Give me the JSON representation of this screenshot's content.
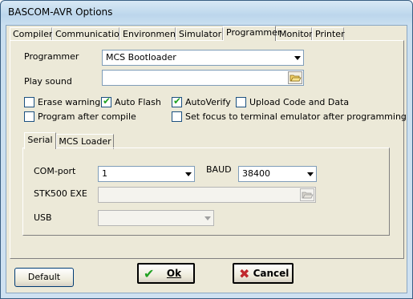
{
  "window": {
    "title": "BASCOM-AVR Options"
  },
  "tabs": [
    {
      "label": "Compiler"
    },
    {
      "label": "Communication"
    },
    {
      "label": "Environment"
    },
    {
      "label": "Simulator"
    },
    {
      "label": "Programmer",
      "active": true
    },
    {
      "label": "Monitor"
    },
    {
      "label": "Printer"
    }
  ],
  "programmer": {
    "label": "Programmer",
    "value": "MCS Bootloader",
    "play_sound_label": "Play sound",
    "play_sound_value": ""
  },
  "options": {
    "erase_warning": {
      "label": "Erase warning",
      "checked": false
    },
    "auto_flash": {
      "label": "Auto Flash",
      "checked": true
    },
    "auto_verify": {
      "label": "AutoVerify",
      "checked": true
    },
    "upload_code": {
      "label": "Upload Code and Data",
      "checked": false
    },
    "program_after_compile": {
      "label": "Program after compile",
      "checked": false
    },
    "set_focus": {
      "label": "Set focus to terminal emulator after programming",
      "checked": false
    }
  },
  "subtabs": [
    {
      "label": "Serial",
      "active": true
    },
    {
      "label": "MCS Loader"
    }
  ],
  "serial": {
    "com_port_label": "COM-port",
    "com_port_value": "1",
    "baud_label": "BAUD",
    "baud_value": "38400",
    "stk500_label": "STK500 EXE",
    "stk500_value": "",
    "usb_label": "USB",
    "usb_value": ""
  },
  "buttons": {
    "default": "Default",
    "ok": "Ok",
    "cancel": "Cancel"
  },
  "colors": {
    "ok_icon": "#21a121",
    "cancel_icon": "#c0282d",
    "checkmark": "#21a121"
  },
  "icons": [
    "folder-open-icon",
    "checkmark-icon",
    "close-x-icon",
    "chevron-down-icon"
  ]
}
